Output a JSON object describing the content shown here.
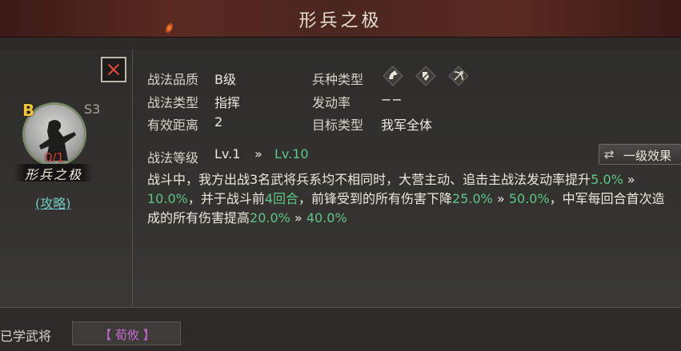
{
  "header": {
    "title": "形兵之极"
  },
  "skill_card": {
    "grade_letter": "B",
    "season": "S3",
    "progress": "0/1",
    "name": "形兵之极",
    "guide_link": "(攻略)"
  },
  "info": {
    "quality_label": "战法品质",
    "quality_value": "B级",
    "type_label": "战法类型",
    "type_value": "指挥",
    "range_label": "有效距离",
    "range_value": "2",
    "troop_label": "兵种类型",
    "troop_icons": [
      "cavalry-icon",
      "shield-icon",
      "archer-icon"
    ],
    "rate_label": "发动率",
    "rate_value": "−−",
    "target_label": "目标类型",
    "target_value": "我军全体",
    "level_label": "战法等级",
    "level_current": "Lv.1",
    "level_arrow": "»",
    "level_next": "Lv.10"
  },
  "effect_button": {
    "icon": "⇄",
    "label": "一级效果"
  },
  "description": [
    {
      "t": "战斗中，我方出战3名武将兵系均不相同时，大营主动、追击主战法发动率提升",
      "c": "w"
    },
    {
      "t": "5.0%",
      "c": "g"
    },
    {
      "t": " » ",
      "c": "w"
    },
    {
      "t": "10.0%",
      "c": "g"
    },
    {
      "t": "，并于战斗前",
      "c": "w"
    },
    {
      "t": "4回合",
      "c": "g"
    },
    {
      "t": "，前锋受到的所有伤害下降",
      "c": "w"
    },
    {
      "t": "25.0%",
      "c": "g"
    },
    {
      "t": " » ",
      "c": "w"
    },
    {
      "t": "50.0%",
      "c": "g"
    },
    {
      "t": "，中军每回合首次造成的所有伤害提高",
      "c": "w"
    },
    {
      "t": "20.0%",
      "c": "g"
    },
    {
      "t": " » ",
      "c": "w"
    },
    {
      "t": "40.0%",
      "c": "g"
    }
  ],
  "bottom": {
    "learned_label": "已学武将",
    "general_name": "【 荀攸 】"
  },
  "colors": {
    "highlight": "#5fc48a",
    "grade": "#f3c13a",
    "link": "#74c7c4",
    "general": "#c86ad0",
    "progress": "#e24b3a"
  }
}
